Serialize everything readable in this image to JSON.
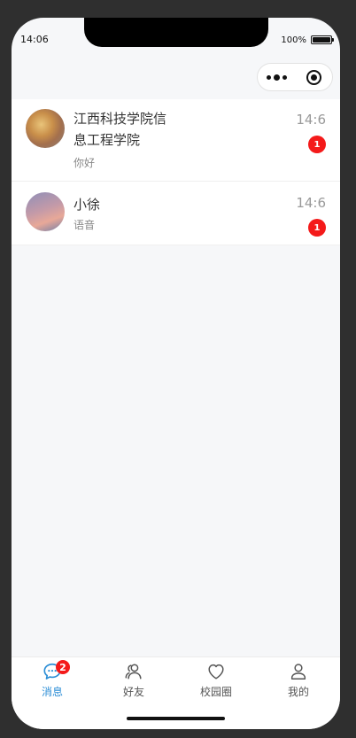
{
  "status_bar": {
    "time": "14:06",
    "battery_text": "100%"
  },
  "chats": [
    {
      "name": "江西科技学院信息工程学院",
      "last_message": "你好",
      "time": "14:6",
      "unread": "1",
      "avatar_icon": "campus-photo-avatar"
    },
    {
      "name": "小徐",
      "last_message": "语音",
      "time": "14:6",
      "unread": "1",
      "avatar_icon": "sky-photo-avatar"
    }
  ],
  "tabbar": {
    "active_color": "#2c8ed6",
    "tabs": [
      {
        "label": "消息",
        "icon": "chat-bubble-icon",
        "badge": "2",
        "active": true
      },
      {
        "label": "好友",
        "icon": "friends-icon",
        "active": false
      },
      {
        "label": "校园圈",
        "icon": "heart-icon",
        "active": false
      },
      {
        "label": "我的",
        "icon": "user-icon",
        "active": false
      }
    ]
  }
}
